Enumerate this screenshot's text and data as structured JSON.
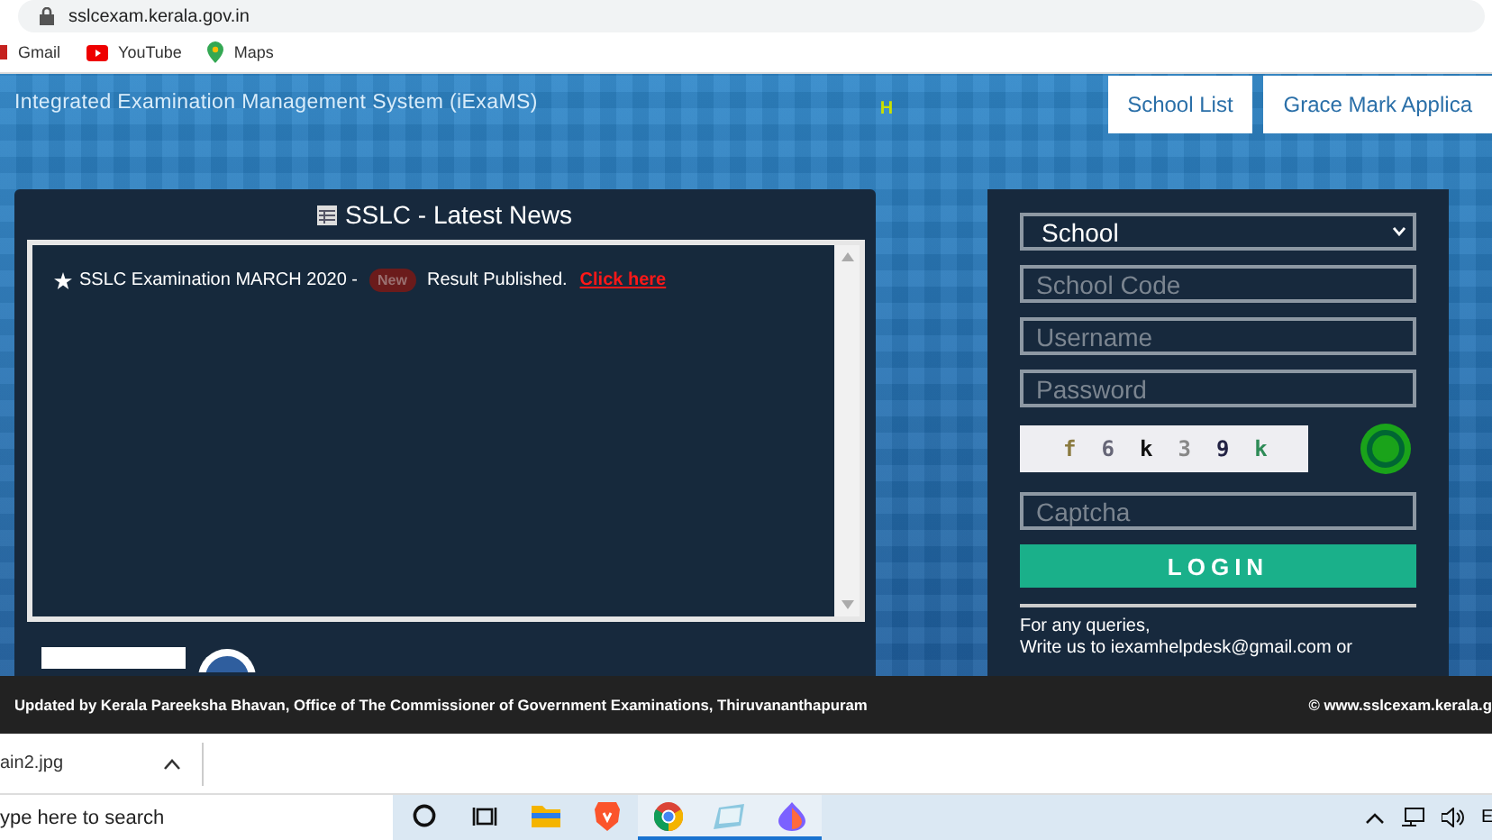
{
  "browser": {
    "url": "sslcexam.kerala.gov.in",
    "bookmarks": [
      {
        "label": "Gmail",
        "kind": "mail"
      },
      {
        "label": "YouTube",
        "kind": "video"
      },
      {
        "label": "Maps",
        "kind": "map"
      }
    ]
  },
  "header": {
    "title": "Integrated Examination Management System (iExaMS)",
    "marquee_text": "H",
    "nav": [
      "School List",
      "Grace Mark Applica"
    ]
  },
  "news": {
    "title": "SSLC - Latest News",
    "items": [
      {
        "text": "SSLC Examination MARCH 2020 -",
        "badge": "New",
        "after": "Result Published.",
        "link": "Click here"
      }
    ]
  },
  "login": {
    "role": "School",
    "fields": [
      {
        "placeholder": "School Code"
      },
      {
        "placeholder": "Username"
      },
      {
        "placeholder": "Password"
      }
    ],
    "captcha": [
      {
        "char": "f",
        "color": "#8a7a40"
      },
      {
        "char": "6",
        "color": "#666677"
      },
      {
        "char": "k",
        "color": "#111111"
      },
      {
        "char": "3",
        "color": "#888888"
      },
      {
        "char": "9",
        "color": "#222244"
      },
      {
        "char": "k",
        "color": "#2e8b57"
      }
    ],
    "captcha_placeholder": "Captcha",
    "button": "LOGIN",
    "help": [
      "For any queries,",
      "Write us to iexamhelpdesk@gmail.com or"
    ]
  },
  "footer": {
    "left": "Updated  by Kerala Pareeksha Bhavan, Office of The Commissioner of Government Examinations, Thiruvananthapuram",
    "right": "© www.sslcexam.kerala.g"
  },
  "download": {
    "file": "ain2.jpg"
  },
  "taskbar": {
    "search_placeholder": "ype here to search",
    "apps": [
      {
        "kind": "cortana",
        "running": false
      },
      {
        "kind": "taskview",
        "running": false
      },
      {
        "kind": "folder",
        "running": false
      },
      {
        "kind": "brave",
        "running": false
      },
      {
        "kind": "chrome",
        "running": true
      },
      {
        "kind": "notes",
        "running": true
      },
      {
        "kind": "paint",
        "running": true
      }
    ],
    "language": "E"
  }
}
